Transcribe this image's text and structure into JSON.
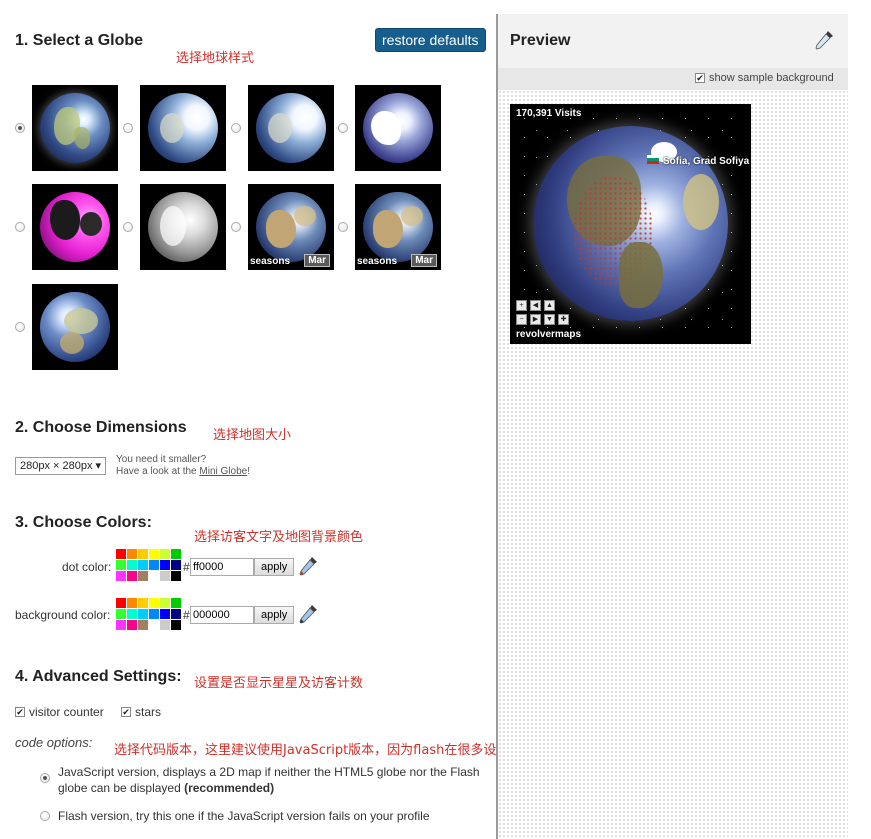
{
  "colors": {
    "accent_button": "#155e8e",
    "annotation_red": "#d0302a",
    "panel_divider": "#9a9a9a"
  },
  "section1": {
    "title": "1. Select a Globe",
    "note": "选择地球样式",
    "restore_label": "restore defaults",
    "globes": [
      {
        "style": "earth-night",
        "selected": true
      },
      {
        "style": "earth-bright",
        "selected": false
      },
      {
        "style": "earth-bright",
        "selected": false
      },
      {
        "style": "white-continents",
        "selected": false
      },
      {
        "style": "pink",
        "selected": false
      },
      {
        "style": "gray",
        "selected": false
      },
      {
        "style": "seasons",
        "selected": false,
        "seasons_label": "seasons",
        "month_label": "Mar"
      },
      {
        "style": "seasons",
        "selected": false,
        "seasons_label": "seasons",
        "month_label": "Mar"
      },
      {
        "style": "europe",
        "selected": false
      }
    ]
  },
  "section2": {
    "title": "2. Choose Dimensions",
    "note": "选择地图大小",
    "select_value": "280px × 280px ▾",
    "hint_line1": "You need it smaller?",
    "hint_prefix": "Have a look at the ",
    "hint_link": "Mini Globe",
    "hint_suffix": "!"
  },
  "section3": {
    "title": "3. Choose Colors:",
    "note": "选择访客文字及地图背景颜色",
    "dot_label": "dot color:",
    "dot_value": "ff0000",
    "bg_label": "background color:",
    "bg_value": "000000",
    "hash": "#",
    "apply_label": "apply",
    "palette": [
      "#ff0000",
      "#ff8800",
      "#ffcc00",
      "#ffff00",
      "#ccff33",
      "#00cc00",
      "#33ff33",
      "#00ffcc",
      "#00ccff",
      "#0088ff",
      "#0000ff",
      "#000088",
      "#ff33ff",
      "#ff0088",
      "#a08060",
      "#ffffff",
      "#cccccc",
      "#000000"
    ]
  },
  "section4": {
    "title": "4. Advanced Settings:",
    "note": "设置是否显示星星及访客计数",
    "visitor_counter_label": "visitor counter",
    "stars_label": "stars",
    "code_options_label": "code options:",
    "code_note": "选择代码版本，这里建议使用JavaScript版本，因为flash在很多设备都没法用了",
    "js_option_line1": "JavaScript version, displays a 2D map if neither the HTML5 globe nor the Flash",
    "js_option_line2": "globe can be displayed ",
    "js_option_bold": "(recommended)",
    "flash_option": "Flash version, try this one if the JavaScript version fails on your profile"
  },
  "preview": {
    "title": "Preview",
    "show_bg_label": "show sample background",
    "visits": "170,391 Visits",
    "location": "Sofia, Grad Sofiya",
    "brand": "revolvermaps"
  }
}
